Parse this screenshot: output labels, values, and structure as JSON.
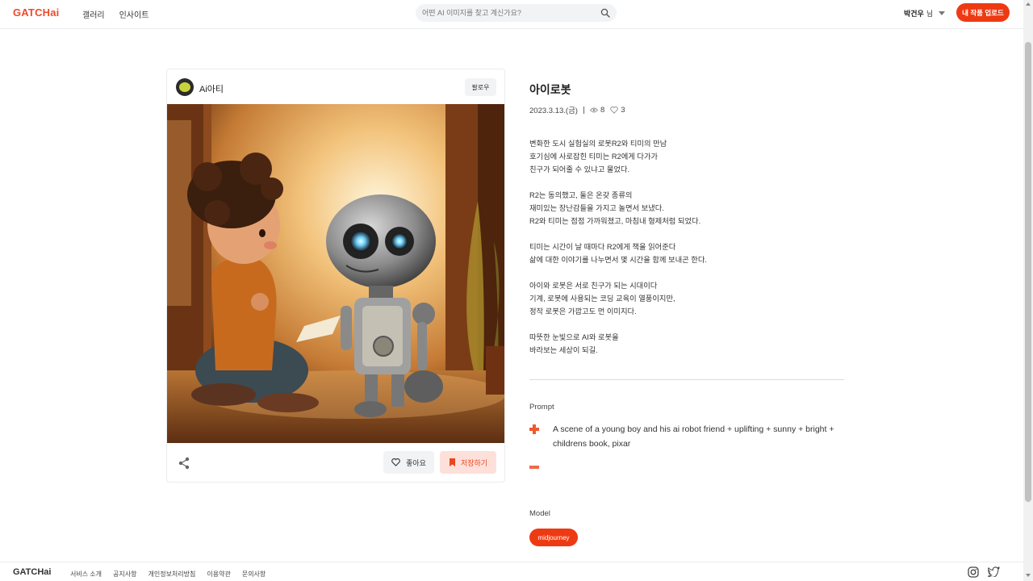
{
  "header": {
    "logo": "GATCHai",
    "nav": [
      "갤러리",
      "인사이트"
    ],
    "search_placeholder": "어떤 AI 이미지를 찾고 계신가요?",
    "user_name": "박건우",
    "user_suffix": "님",
    "upload_label": "내 작품 업로드"
  },
  "card": {
    "author": "Ai아티",
    "follow_label": "팔로우",
    "like_label": "좋아요",
    "save_label": "저장하기"
  },
  "detail": {
    "title": "아이로봇",
    "date": "2023.3.13.(금)",
    "views": "8",
    "likes": "3",
    "description": [
      [
        "변화한 도시 실험실의 로봇R2와 티미의 만남",
        "호기심에 사로잡힌 티미는 R2에게 다가가",
        "친구가 되어줄 수 있냐고 물었다."
      ],
      [
        "R2는 동의했고, 둘은 온갖 종류의",
        "재미있는 장난감들을 가지고 놀면서 보냈다.",
        "R2와 티미는 점점 가까워졌고, 마침내 형제처럼 되었다."
      ],
      [
        "티미는 시간이 날 때마다 R2에게 책을 읽어준다",
        "삶에 대한 이야기를 나누면서 몇 시간을 함께 보내곤 한다."
      ],
      [
        "아이와 로봇은 서로 친구가 되는 시대이다",
        "기계, 로봇에 사용되는 코딩 교육이 열풍이지만,",
        "정작 로봇은 가깝고도 먼 이미지다."
      ],
      [
        "따뜻한 눈빛으로 AI와 로봇을",
        "바라보는 세상이 되길."
      ]
    ],
    "prompt_label": "Prompt",
    "prompt_text": "A scene of a young boy and his ai robot friend + uplifting + sunny + bright + childrens book, pixar",
    "model_label": "Model",
    "model_value": "midjourney"
  },
  "footer": {
    "logo": "GATCHai",
    "links": [
      "서비스 소개",
      "공지사항",
      "개인정보처리방침",
      "이용약관",
      "문의사항"
    ]
  },
  "colors": {
    "accent": "#ee3a12",
    "accent_light": "#fde0da"
  },
  "icons": [
    "search-icon",
    "chevron-down-icon",
    "eye-icon",
    "heart-icon",
    "share-icon",
    "bookmark-icon",
    "plus-icon",
    "minus-icon",
    "instagram-icon",
    "twitter-icon"
  ]
}
